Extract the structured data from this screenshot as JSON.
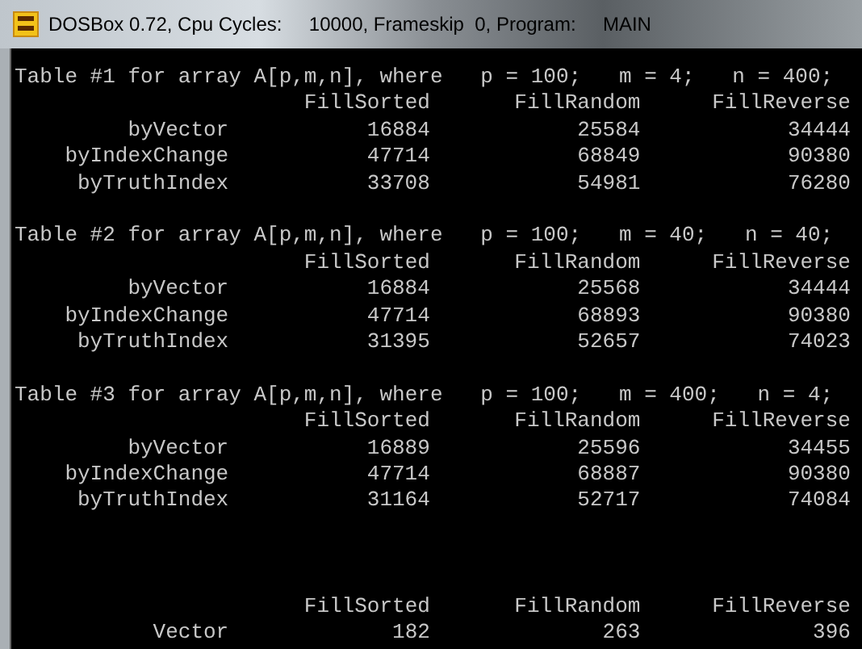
{
  "window": {
    "title": "DOSBox 0.72, Cpu Cycles:     10000, Frameskip  0, Program:     MAIN"
  },
  "blocks": [
    {
      "kind": "table",
      "heading": "Table #1 for array A[p,m,n], where   p = 100;   m = 4;   n = 400;",
      "columns": [
        "FillSorted",
        "FillRandom",
        "FillReverse"
      ],
      "rows": [
        {
          "label": "byVector",
          "values": [
            "16884",
            "25584",
            "34444"
          ]
        },
        {
          "label": "byIndexChange",
          "values": [
            "47714",
            "68849",
            "90380"
          ]
        },
        {
          "label": "byTruthIndex",
          "values": [
            "33708",
            "54981",
            "76280"
          ]
        }
      ]
    },
    {
      "kind": "table",
      "heading": "Table #2 for array A[p,m,n], where   p = 100;   m = 40;   n = 40;",
      "columns": [
        "FillSorted",
        "FillRandom",
        "FillReverse"
      ],
      "rows": [
        {
          "label": "byVector",
          "values": [
            "16884",
            "25568",
            "34444"
          ]
        },
        {
          "label": "byIndexChange",
          "values": [
            "47714",
            "68893",
            "90380"
          ]
        },
        {
          "label": "byTruthIndex",
          "values": [
            "31395",
            "52657",
            "74023"
          ]
        }
      ]
    },
    {
      "kind": "table",
      "heading": "Table #3 for array A[p,m,n], where   p = 100;   m = 400;   n = 4;",
      "columns": [
        "FillSorted",
        "FillRandom",
        "FillReverse"
      ],
      "rows": [
        {
          "label": "byVector",
          "values": [
            "16889",
            "25596",
            "34455"
          ]
        },
        {
          "label": "byIndexChange",
          "values": [
            "47714",
            "68887",
            "90380"
          ]
        },
        {
          "label": "byTruthIndex",
          "values": [
            "31164",
            "52717",
            "74084"
          ]
        }
      ]
    },
    {
      "kind": "summary",
      "columns": [
        "FillSorted",
        "FillRandom",
        "FillReverse"
      ],
      "rows": [
        {
          "label": "Vector",
          "values": [
            "182",
            "263",
            "396"
          ]
        }
      ]
    }
  ]
}
